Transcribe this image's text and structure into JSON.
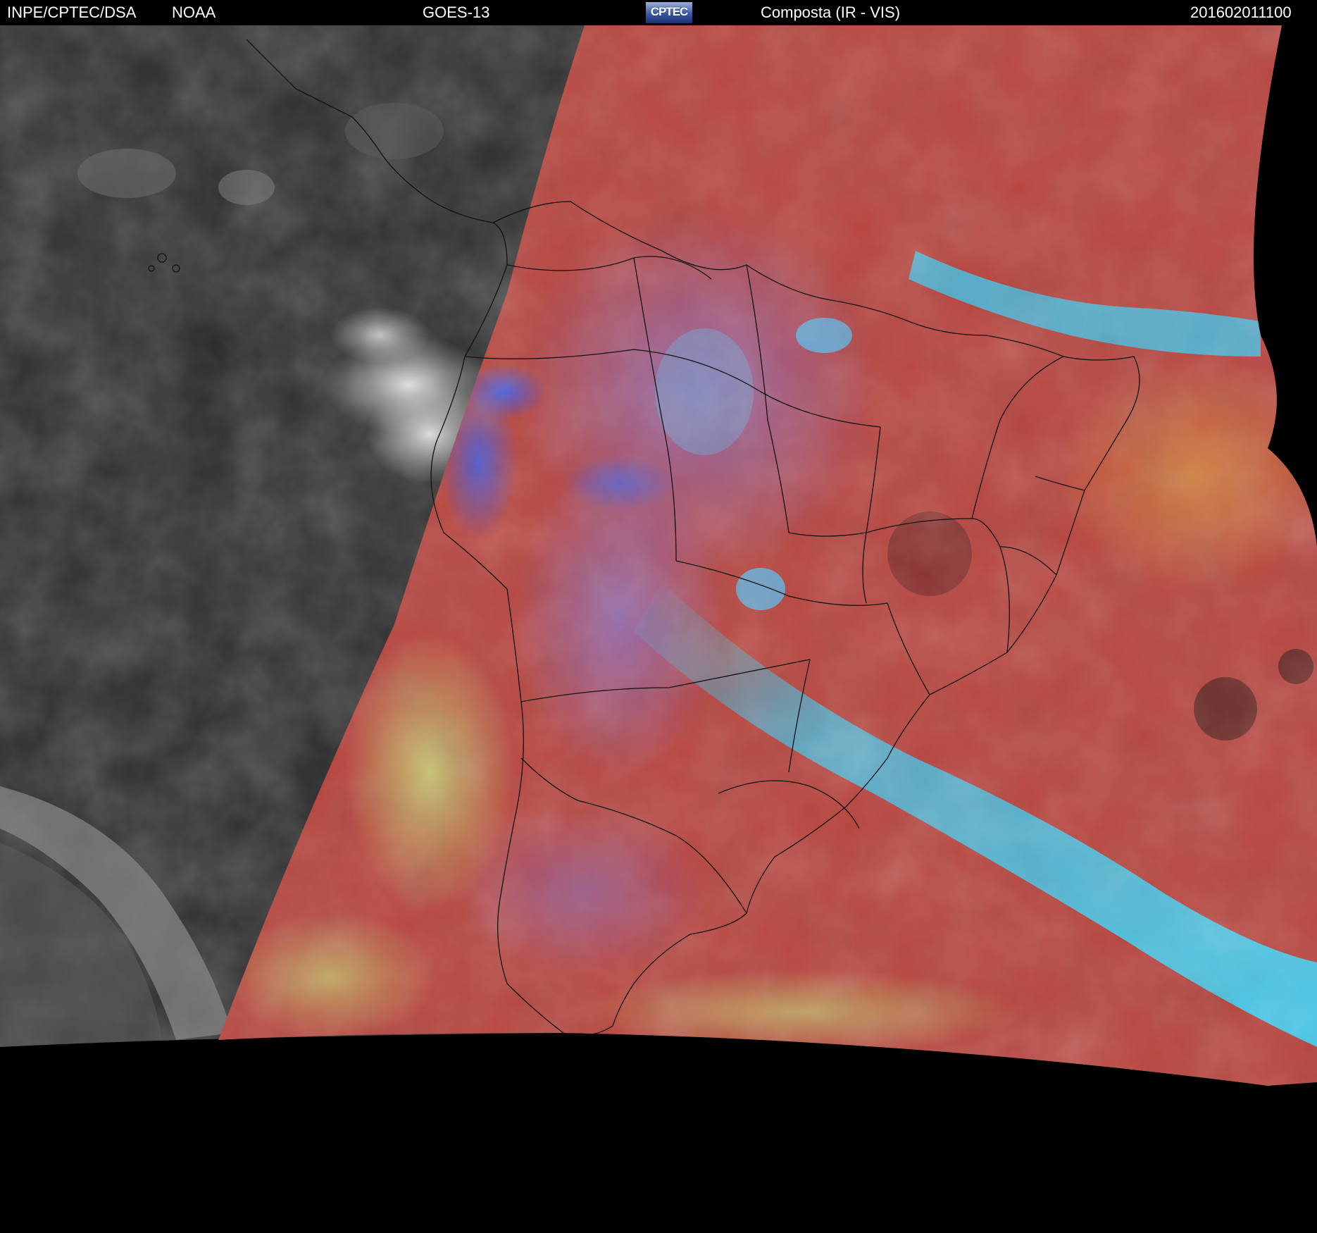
{
  "header": {
    "institution": "INPE/CPTEC/DSA",
    "agency": "NOAA",
    "satellite": "GOES-13",
    "logo_text": "CPTEC",
    "product": "Composta (IR - VIS)",
    "timestamp": "201602011100"
  },
  "colors": {
    "night_side": "#2b2b2b",
    "day_red": "#b8443e",
    "day_cyan": "#3fc7ec",
    "day_yellow_green": "#b6c46a",
    "day_blue": "#3d56e0",
    "borders": "#111111",
    "background": "#000000"
  },
  "icons": {
    "logo": "cptec-logo"
  }
}
